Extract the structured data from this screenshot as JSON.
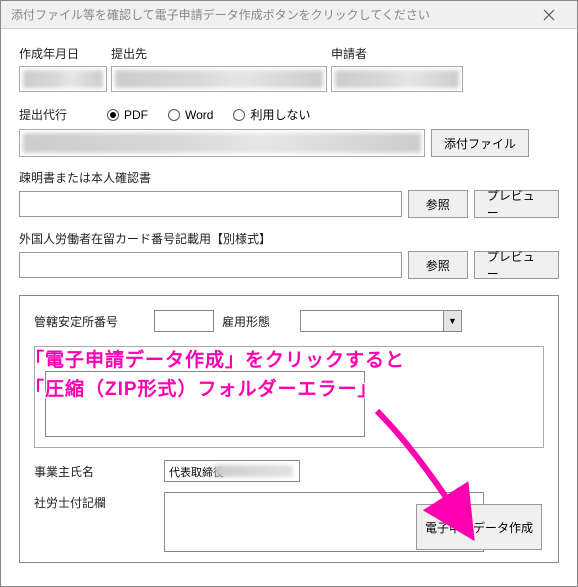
{
  "window": {
    "title": "添付ファイル等を確認して電子申請データ作成ボタンをクリックしてください"
  },
  "header": {
    "date_label": "作成年月日",
    "dest_label": "提出先",
    "applicant_label": "申請者"
  },
  "proxy": {
    "label": "提出代行",
    "options": {
      "pdf": "PDF",
      "word": "Word",
      "none": "利用しない"
    },
    "selected": "pdf"
  },
  "attach_btn": "添付ファイル",
  "section1": {
    "label": "疎明書または本人確認書"
  },
  "section2": {
    "label": "外国人労働者在留カード番号記載用【別様式】"
  },
  "browse_btn": "参照",
  "preview_btn": "プレビュー",
  "inner": {
    "kanri_label": "管轄安定所番号",
    "koyo_label": "雇用形態",
    "jigyo_label": "事業主氏名",
    "jigyo_value": "代表取締役",
    "remarks_label": "社労士付記欄"
  },
  "submit_btn": "電子申請データ作成",
  "overlay": {
    "line1": "「電子申請データ作成」をクリックすると",
    "line2": "「圧縮（ZIP形式）フォルダーエラー」"
  }
}
